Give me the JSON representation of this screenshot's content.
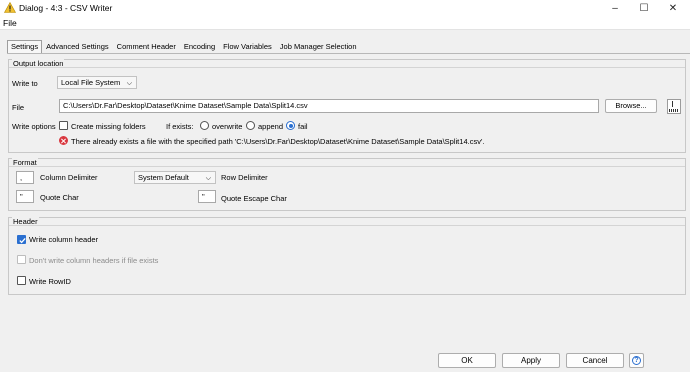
{
  "window": {
    "title": "Dialog - 4:3 - CSV Writer",
    "min_glyph": "–",
    "max_glyph": "☐",
    "close_glyph": "✕",
    "warning_color": "#f0c030"
  },
  "menu": {
    "file": "File"
  },
  "tabs": [
    {
      "label": "Settings",
      "active": true
    },
    {
      "label": "Advanced Settings"
    },
    {
      "label": "Comment Header"
    },
    {
      "label": "Encoding"
    },
    {
      "label": "Flow Variables"
    },
    {
      "label": "Job Manager Selection"
    }
  ],
  "output": {
    "title": "Output location",
    "write_to_label": "Write to",
    "write_to_value": "Local File System",
    "file_label": "File",
    "file_value": "C:\\Users\\Dr.Far\\Desktop\\Dataset\\Knime Dataset\\Sample Data\\Split14.csv",
    "browse_label": "Browse...",
    "write_options_label": "Write options",
    "create_missing_folders": "Create missing folders",
    "if_exists_label": "If exists:",
    "overwrite": "overwrite",
    "append": "append",
    "fail": "fail",
    "selected_if_exists": "fail",
    "error_message": "There already exists a file with the specified path 'C:\\Users\\Dr.Far\\Desktop\\Dataset\\Knime Dataset\\Sample Data\\Split14.csv'."
  },
  "format": {
    "title": "Format",
    "column_delimiter_value": ",",
    "column_delimiter_label": "Column Delimiter",
    "row_delimiter_value": "System Default",
    "row_delimiter_label": "Row Delimiter",
    "quote_char_value": "\"",
    "quote_char_label": "Quote Char",
    "quote_escape_value": "\"",
    "quote_escape_label": "Quote Escape Char"
  },
  "header": {
    "title": "Header",
    "write_column_header": "Write column header",
    "write_column_header_checked": true,
    "dont_write_if_exists": "Don't write column headers if file exists",
    "write_rowid": "Write RowID"
  },
  "footer": {
    "ok": "OK",
    "apply": "Apply",
    "cancel": "Cancel",
    "help": "?"
  },
  "colors": {
    "accent": "#2a6fd0",
    "error": "#d9383f"
  }
}
